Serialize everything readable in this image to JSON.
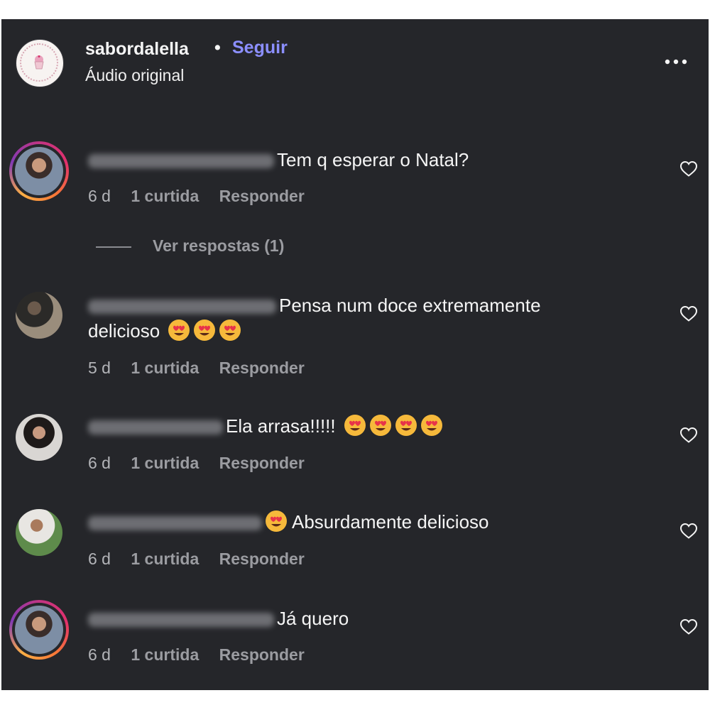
{
  "header": {
    "username": "sabordalella",
    "separator": "•",
    "follow_label": "Seguir",
    "audio_label": "Áudio original"
  },
  "comments": [
    {
      "text": "Tem q esperar o Natal?",
      "age": "6 d",
      "likes": "1 curtida",
      "reply_label": "Responder"
    },
    {
      "text": "Pensa num doce extremamente",
      "text_line2": "delicioso",
      "age": "5 d",
      "likes": "1 curtida",
      "reply_label": "Responder"
    },
    {
      "text": "Ela arrasa!!!!!",
      "age": "6 d",
      "likes": "1 curtida",
      "reply_label": "Responder"
    },
    {
      "text": "Absurdamente delicioso",
      "age": "6 d",
      "likes": "1 curtida",
      "reply_label": "Responder"
    },
    {
      "text": "Já quero",
      "age": "6 d",
      "likes": "1 curtida",
      "reply_label": "Responder"
    }
  ],
  "view_replies_label": "Ver respostas (1)",
  "colors": {
    "background": "#25262a",
    "accent": "#8c8fff",
    "muted_text": "#9b9ca1"
  },
  "icons": {
    "more": "more-horizontal-icon",
    "like": "heart-outline-icon",
    "emoji": "smiling-face-with-heart-eyes-emoji"
  }
}
